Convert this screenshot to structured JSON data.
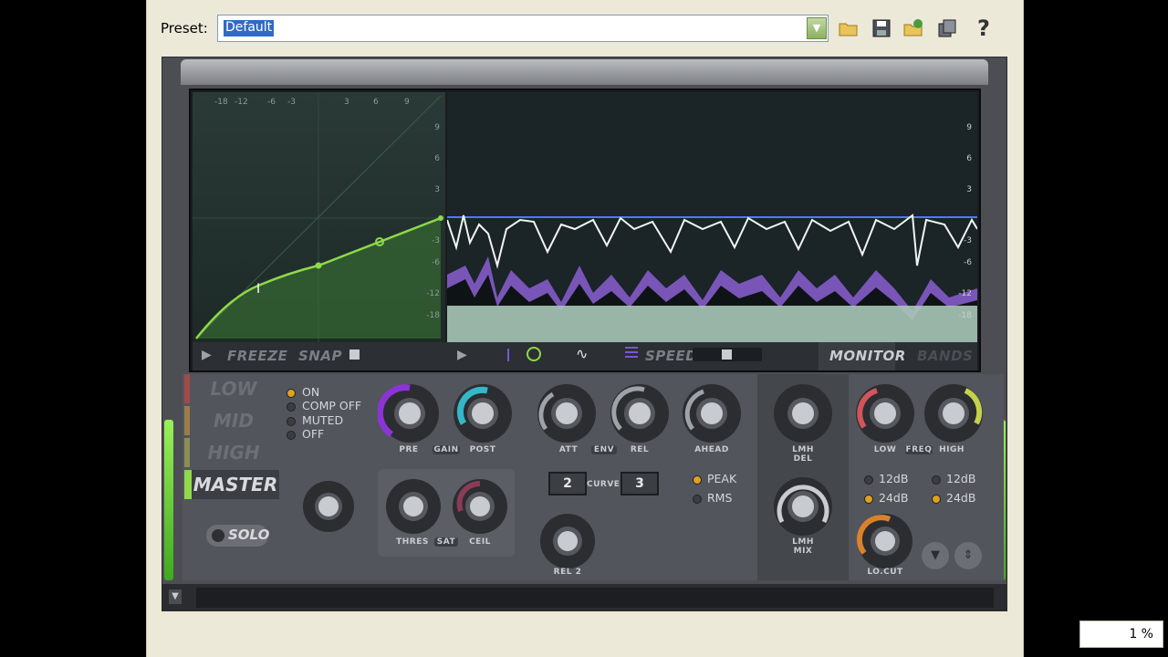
{
  "preset": {
    "label": "Preset:",
    "value": "Default"
  },
  "toolbar": {
    "icons": [
      "folder-open-icon",
      "save-icon",
      "browse-icon",
      "copy-icon",
      "help-icon"
    ],
    "help_label": "?"
  },
  "display": {
    "tf_top_ticks": [
      "-18",
      "-12",
      "-6",
      "-3",
      "3",
      "6",
      "9"
    ],
    "tf_right_ticks": [
      "9",
      "6",
      "3",
      "-3",
      "-6",
      "-12",
      "-18"
    ],
    "wave_right_ticks": [
      "9",
      "6",
      "3",
      "-3",
      "-6",
      "-12",
      "-18"
    ],
    "freeze_label": "FREEZE",
    "snap_label": "SNAP",
    "speed_label": "SPEED",
    "monitor_label": "MONITOR",
    "bands_label": "BANDS"
  },
  "bands": {
    "low": "LOW",
    "mid": "MID",
    "high": "HIGH",
    "master": "MASTER"
  },
  "modes": [
    "ON",
    "COMP OFF",
    "MUTED",
    "OFF"
  ],
  "solo_label": "SOLO",
  "knobs": {
    "pre": "PRE",
    "gain": "GAIN",
    "post": "POST",
    "thres": "THRES",
    "sat": "SAT",
    "ceil": "CEIL",
    "att": "ATT",
    "env": "ENV",
    "rel": "REL",
    "ahead": "AHEAD",
    "curve": "CURVE",
    "rel2": "REL 2",
    "lmh_del": "LMH DEL",
    "lmh_mix": "LMH MIX",
    "low": "LOW",
    "freq": "FREQ",
    "high": "HIGH",
    "locut": "LO.CUT"
  },
  "curve_values": {
    "left": "2",
    "right": "3"
  },
  "detect": [
    "PEAK",
    "RMS"
  ],
  "slopes_low": [
    "12dB",
    "24dB"
  ],
  "slopes_high": [
    "12dB",
    "24dB"
  ],
  "status": {
    "percent": "1 %"
  },
  "colors": {
    "accent_green": "#8fd94a",
    "threshold_blue": "#4a7cff",
    "pre_purple": "#8b34d6",
    "post_cyan": "#35b7c7",
    "ceil_maroon": "#8a3b56",
    "low_red": "#d1555c",
    "high_yellow": "#c4d24b",
    "locut_orange": "#d9822b"
  }
}
